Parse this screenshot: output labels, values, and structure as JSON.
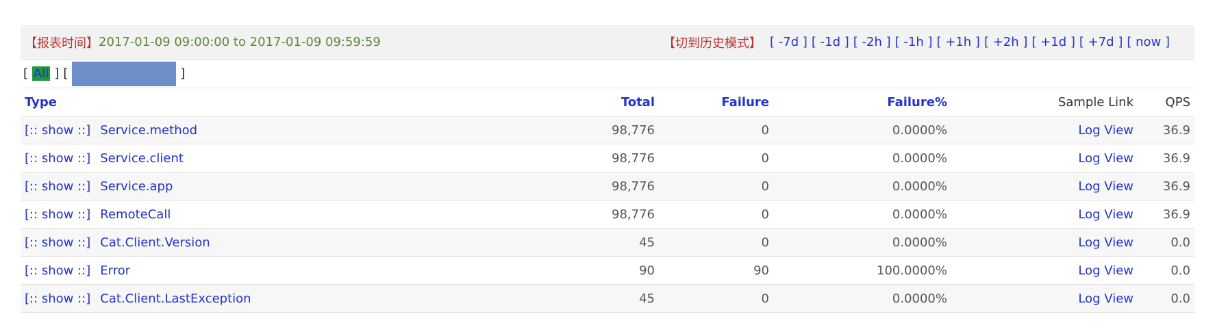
{
  "header": {
    "time_label": "【报表时间】",
    "time_range": "2017-01-09 09:00:00 to 2017-01-09 09:59:59",
    "mode_label": "【切到历史模式】",
    "nav": [
      "-7d",
      "-1d",
      "-2h",
      "-1h",
      "+1h",
      "+2h",
      "+1d",
      "+7d",
      "now"
    ]
  },
  "filter": {
    "all_label": "All"
  },
  "table": {
    "columns": [
      "Type",
      "Total",
      "Failure",
      "Failure%",
      "Sample Link",
      "QPS"
    ],
    "show_label": "[:: show ::]",
    "rows": [
      {
        "type": "Service.method",
        "total": "98,776",
        "failure": "0",
        "failure_pct": "0.0000%",
        "link": "Log View",
        "qps": "36.9"
      },
      {
        "type": "Service.client",
        "total": "98,776",
        "failure": "0",
        "failure_pct": "0.0000%",
        "link": "Log View",
        "qps": "36.9"
      },
      {
        "type": "Service.app",
        "total": "98,776",
        "failure": "0",
        "failure_pct": "0.0000%",
        "link": "Log View",
        "qps": "36.9"
      },
      {
        "type": "RemoteCall",
        "total": "98,776",
        "failure": "0",
        "failure_pct": "0.0000%",
        "link": "Log View",
        "qps": "36.9"
      },
      {
        "type": "Cat.Client.Version",
        "total": "45",
        "failure": "0",
        "failure_pct": "0.0000%",
        "link": "Log View",
        "qps": "0.0"
      },
      {
        "type": "Error",
        "total": "90",
        "failure": "90",
        "failure_pct": "100.0000%",
        "link": "Log View",
        "qps": "0.0"
      },
      {
        "type": "Cat.Client.LastException",
        "total": "45",
        "failure": "0",
        "failure_pct": "0.0000%",
        "link": "Log View",
        "qps": "0.0"
      }
    ]
  },
  "colors": {
    "link": "#2233cc",
    "label_red": "#b33",
    "time_green": "#5a8a2f",
    "all_highlight": "#1d9a3a",
    "redacted_box": "#6d8fc9"
  }
}
